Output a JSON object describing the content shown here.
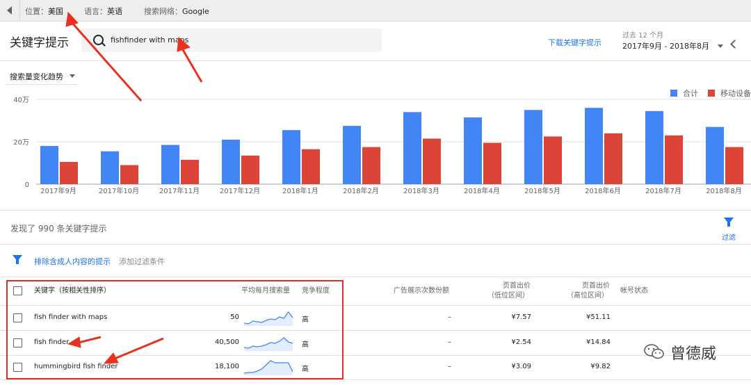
{
  "topbar": {
    "location_label": "位置：",
    "location_value": "美国",
    "language_label": "语言：",
    "language_value": "英语",
    "network_label": "搜索网络：",
    "network_value": "Google"
  },
  "header": {
    "title": "关键字提示",
    "search_value": "fishfinder with maps",
    "download_link": "下载关键字提示",
    "range_label": "过去 12 个月",
    "range_value": "2017年9月 - 2018年8月"
  },
  "chart_section": {
    "trend_label": "搜索量变化趋势",
    "legend_total": "合计",
    "legend_mobile": "移动设备"
  },
  "colors": {
    "total": "#4285f4",
    "mobile": "#db4437",
    "link": "#1a73e8",
    "annot": "#e8321f"
  },
  "chart_data": {
    "type": "bar",
    "categories": [
      "2017年9月",
      "2017年10月",
      "2017年11月",
      "2017年12月",
      "2018年1月",
      "2018年2月",
      "2018年3月",
      "2018年4月",
      "2018年5月",
      "2018年6月",
      "2018年7月",
      "2018年8月"
    ],
    "series": [
      {
        "name": "合计",
        "values": [
          18,
          15.5,
          18.5,
          21,
          25.5,
          27.5,
          34,
          31.5,
          35,
          36,
          34.5,
          27
        ]
      },
      {
        "name": "移动设备",
        "values": [
          10.5,
          9,
          11.5,
          13.5,
          16.5,
          17.5,
          21.5,
          19.5,
          22.5,
          24,
          23,
          17.5
        ]
      }
    ],
    "ytick_labels": [
      "0",
      "20万",
      "40万"
    ],
    "ytick_values": [
      0,
      20,
      40
    ],
    "ylim": [
      0,
      40
    ],
    "grid": true,
    "legend_position": "top-right"
  },
  "results": {
    "found_text": "发现了 990 条关键字提示",
    "filter_label": "过滤",
    "exclude_adult": "排除含成人内容的提示",
    "add_filter": "添加过滤条件"
  },
  "table": {
    "headers": {
      "keyword": "关键字（按相关性排序）",
      "avg_searches": "平均每月搜索量",
      "competition": "竞争程度",
      "impression_share": "广告展示次数份额",
      "bid_low_1": "页首出价",
      "bid_low_2": "（低位区间）",
      "bid_high_1": "页首出价",
      "bid_high_2": "（高位区间）",
      "account_status": "帐号状态"
    },
    "rows": [
      {
        "keyword": "fish finder with maps",
        "avg": "50",
        "trend": [
          0.15,
          0.1,
          0.3,
          0.25,
          0.2,
          0.35,
          0.45,
          0.4,
          0.6,
          0.5,
          0.95,
          0.55
        ],
        "competition": "高",
        "share": "–",
        "low": "¥7.57",
        "high": "¥51.11"
      },
      {
        "keyword": "fish finder",
        "avg": "40,500",
        "trend": [
          0.2,
          0.15,
          0.3,
          0.25,
          0.3,
          0.4,
          0.55,
          0.5,
          0.65,
          0.9,
          0.6,
          0.5
        ],
        "competition": "高",
        "share": "–",
        "low": "¥2.54",
        "high": "¥14.84"
      },
      {
        "keyword": "hummingbird fish finder",
        "avg": "18,100",
        "trend": [
          0.1,
          0.15,
          0.15,
          0.25,
          0.4,
          0.7,
          1.0,
          0.85,
          0.85,
          0.85,
          0.85,
          0.2
        ],
        "competition": "高",
        "share": "–",
        "low": "¥3.09",
        "high": "¥9.82"
      }
    ]
  },
  "watermark": "曾德威"
}
